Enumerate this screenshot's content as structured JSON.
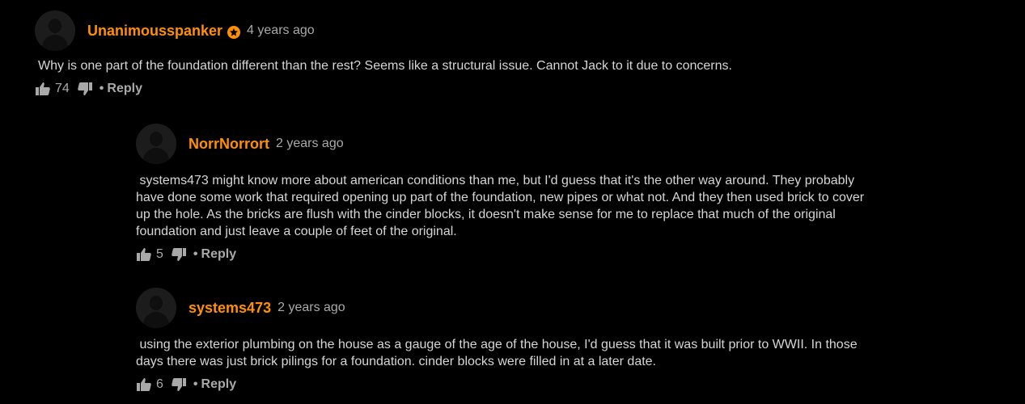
{
  "colors": {
    "background": "#000000",
    "username": "#ff9000",
    "text": "#d6d6d6",
    "muted": "#a9a9a9"
  },
  "comments": [
    {
      "username": "Unanimousspanker",
      "badge_icon": "star-badge-icon",
      "time": "4 years ago",
      "text": "Why is one part of the foundation different than the rest? Seems like a structural issue. Cannot Jack to it due to concerns.",
      "likes": "74",
      "dot": "•",
      "reply_label": "Reply"
    },
    {
      "username": "NorrNorrort",
      "time": "2 years ago",
      "text": " systems473 might know more about american conditions than me, but I'd guess that it's the other way around. They probably\nhave done some work that required opening up part of the foundation, new pipes or what not. And they then used brick to cover\nup the hole. As the bricks are flush with the cinder blocks, it doesn't make sense for me to replace that much of the original\nfoundation and just leave a couple of feet of the original.",
      "likes": "5",
      "dot": "•",
      "reply_label": "Reply"
    },
    {
      "username": "systems473",
      "time": "2 years ago",
      "text": " using the exterior plumbing on the house as a gauge of the age of the house, I'd guess that it was built prior to WWII. In those\ndays there was just brick pilings for a foundation. cinder blocks were filled in at a later date.",
      "likes": "6",
      "dot": "•",
      "reply_label": "Reply"
    }
  ]
}
